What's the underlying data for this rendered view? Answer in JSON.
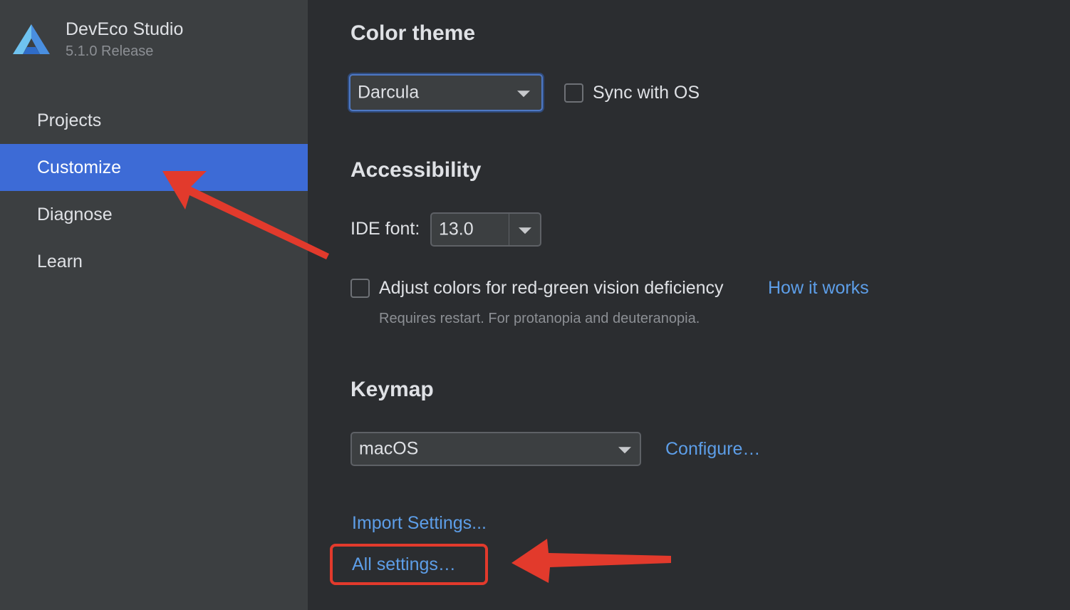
{
  "app": {
    "name": "DevEco Studio",
    "version": "5.1.0 Release"
  },
  "sidebar": {
    "items": [
      {
        "label": "Projects",
        "selected": false
      },
      {
        "label": "Customize",
        "selected": true
      },
      {
        "label": "Diagnose",
        "selected": false
      },
      {
        "label": "Learn",
        "selected": false
      }
    ]
  },
  "color_theme": {
    "title": "Color theme",
    "selected": "Darcula",
    "sync_label": "Sync with OS",
    "sync_checked": false
  },
  "accessibility": {
    "title": "Accessibility",
    "ide_font_label": "IDE font:",
    "ide_font_value": "13.0",
    "adjust_colors_label": "Adjust colors for red-green vision deficiency",
    "adjust_colors_checked": false,
    "how_it_works": "How it works",
    "hint": "Requires restart. For protanopia and deuteranopia."
  },
  "keymap": {
    "title": "Keymap",
    "selected": "macOS",
    "configure": "Configure…"
  },
  "links": {
    "import_settings": "Import Settings...",
    "all_settings": "All settings…"
  },
  "colors": {
    "accent": "#3d6bd6",
    "link": "#5d9ee8",
    "annotation": "#e23a2c"
  }
}
